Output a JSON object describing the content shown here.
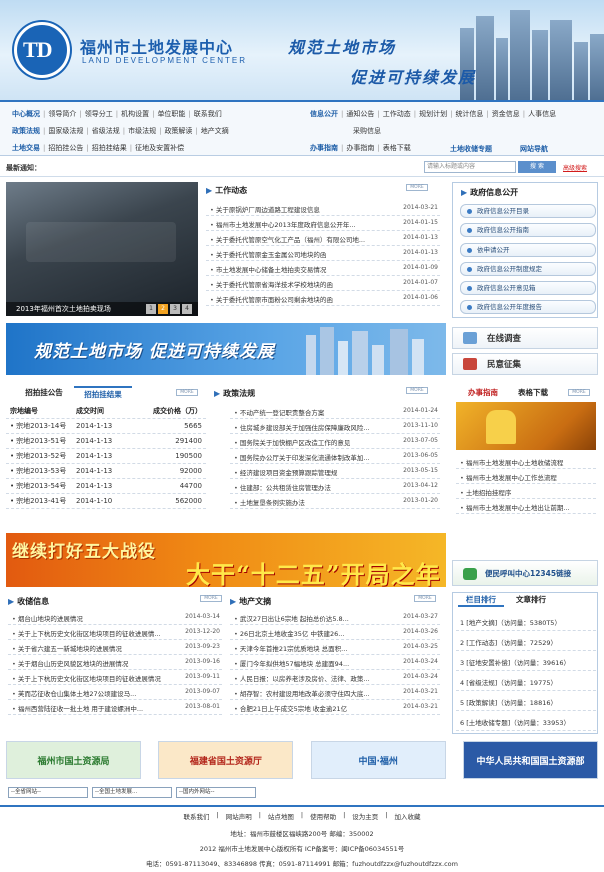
{
  "header": {
    "logo_mark": "TD",
    "title_cn": "福州市土地发展中心",
    "title_en": "LAND DEVELOPMENT CENTER",
    "slogan_line1": "规范土地市场",
    "slogan_line2": "促进可持续发展"
  },
  "nav": {
    "row1_group1": {
      "heading": "中心概况",
      "items": [
        "领导简介",
        "领导分工",
        "机构设置",
        "单位职能",
        "联系我们"
      ]
    },
    "row1_group2": {
      "heading": "信息公开",
      "items": [
        "通知公告",
        "工作动态",
        "规划计划",
        "统计信息",
        "资金信息",
        "人事信息"
      ]
    },
    "row2_group1": {
      "heading": "政策法规",
      "items": [
        "国家级法规",
        "省级法规",
        "市级法规",
        "政策解读",
        "地产文摘"
      ]
    },
    "row2_group2": {
      "items": [
        "采购信息"
      ]
    },
    "row3_group1": {
      "heading": "土地交易",
      "items": [
        "招拍挂公告",
        "招拍挂结果",
        "征地及安置补偿"
      ]
    },
    "row3_group2": {
      "heading": "办事指南",
      "items": [
        "办事指南",
        "表格下载"
      ]
    },
    "row3_extra1": "土地收储专题",
    "row3_extra2": "网站导航"
  },
  "notice": {
    "label": "最新通知：",
    "search_placeholder": "请输入标题或内容",
    "search_button": "搜 索",
    "advanced": "高级搜索"
  },
  "slideshow": {
    "caption": "2013年福州首次土地拍卖现场",
    "pages": [
      "1",
      "2",
      "3",
      "4"
    ],
    "active": "2"
  },
  "work": {
    "title": "工作动态",
    "more": "MORE",
    "items": [
      {
        "t": "关于原锅炉厂周边道路工程建设信息",
        "d": "2014-03-21"
      },
      {
        "t": "福州市土地发展中心2013年度政府信息公开年...",
        "d": "2014-01-15"
      },
      {
        "t": "关于委托代管原空气化工产品（福州）有限公司地...",
        "d": "2014-01-13"
      },
      {
        "t": "关于委托代管原金玉金属公司地块的函",
        "d": "2014-01-13"
      },
      {
        "t": "市土地发展中心储备土地拍卖交易情况",
        "d": "2014-01-09"
      },
      {
        "t": "关于委托代管原省海洋技术学校地块的函",
        "d": "2014-01-07"
      },
      {
        "t": "关于委托代管原市面粉公司剩余地块的函",
        "d": "2014-01-06"
      }
    ]
  },
  "gov": {
    "title": "政府信息公开",
    "items": [
      "政府信息公开目录",
      "政府信息公开指南",
      "依申请公开",
      "政府信息公开制度规定",
      "政府信息公开意见箱",
      "政府信息公开年度报告"
    ]
  },
  "banner1_text": "规范土地市场  促进可持续发展",
  "online_survey": "在线调查",
  "opinion": "民意征集",
  "tender": {
    "tab1": "招拍挂公告",
    "tab2": "招拍挂结果",
    "more": "MORE",
    "headers": [
      "宗地编号",
      "成交时间",
      "成交价格（万）"
    ],
    "rows": [
      [
        "宗地2013-14号",
        "2014-1-13",
        "5665"
      ],
      [
        "宗地2013-51号",
        "2014-1-13",
        "291400"
      ],
      [
        "宗地2013-52号",
        "2014-1-13",
        "190500"
      ],
      [
        "宗地2013-53号",
        "2014-1-13",
        "92000"
      ],
      [
        "宗地2013-54号",
        "2014-1-13",
        "44700"
      ],
      [
        "宗地2013-41号",
        "2014-1-10",
        "562000"
      ]
    ]
  },
  "policy": {
    "title": "政策法规",
    "more": "MORE",
    "items": [
      {
        "t": "不动产统一登记职责整合方案",
        "d": "2014-01-24"
      },
      {
        "t": "住房城乡建设部关于加强住房保障廉政风险...",
        "d": "2013-11-10"
      },
      {
        "t": "国务院关于加快棚户区改造工作的意见",
        "d": "2013-07-05"
      },
      {
        "t": "国务院办公厅关于印发深化流通体制改革加...",
        "d": "2013-06-05"
      },
      {
        "t": "经济建设项目资金预算跟踪管理规",
        "d": "2013-05-15"
      },
      {
        "t": "住建部：公共租赁住房管理办法",
        "d": "2013-04-12"
      },
      {
        "t": "土地复垦条例实施办法",
        "d": "2013-01-20"
      }
    ]
  },
  "guide": {
    "tab1": "办事指南",
    "tab2": "表格下载",
    "more": "MORE",
    "items": [
      "福州市土地发展中心土地收储流程",
      "福州市土地发展中心工作总流程",
      "土地招拍挂程序",
      "福州市土地发展中心土地出让前期..."
    ]
  },
  "banner2": {
    "line1": "继续打好五大战役",
    "line2": "大干“十二五”开局之年"
  },
  "hotline": "便民呼叫中心12345链接",
  "acquisition": {
    "title": "收储信息",
    "more": "MORE",
    "items": [
      {
        "t": "烟台山地块的进展情况",
        "d": "2014-03-14"
      },
      {
        "t": "关于上下杭历史文化街区地块项目的征收进展情...",
        "d": "2013-12-20"
      },
      {
        "t": "关于省六建五一新城地块的进展情况",
        "d": "2013-09-23"
      },
      {
        "t": "关于烟台山历史风貌区地块的进展情况",
        "d": "2013-09-16"
      },
      {
        "t": "关于上下杭历史文化街区地块项目的征收进展情况",
        "d": "2013-09-11"
      },
      {
        "t": "芙而芯征收仓山集体土地27公顷建设马...",
        "d": "2013-09-07"
      },
      {
        "t": "福州西营陆征收一批土地   用于建设螺洲中...",
        "d": "2013-08-01"
      }
    ]
  },
  "realestate": {
    "title": "地产文摘",
    "more": "MORE",
    "items": [
      {
        "t": "武汉27日出让6宗地  起拍总价达5.8...",
        "d": "2014-03-27"
      },
      {
        "t": "26日北京土地收金35亿  中铁建26...",
        "d": "2014-03-26"
      },
      {
        "t": "天津今年首推21宗优质地块  总面积...",
        "d": "2014-03-25"
      },
      {
        "t": "厦门今年拟供地57幅地块  总建面94...",
        "d": "2014-03-24"
      },
      {
        "t": "人民日报：以房养老涉及房价、法律、政策...",
        "d": "2014-03-24"
      },
      {
        "t": "胡存智：农村建设用地改革必须守住四大底...",
        "d": "2014-03-21"
      },
      {
        "t": "合肥21日上午成交5宗地  收金逾21亿",
        "d": "2014-03-21"
      }
    ]
  },
  "ranking": {
    "tab1": "栏目排行",
    "tab2": "文章排行",
    "items": [
      {
        "rank": "1",
        "name": "[地产文摘]",
        "visits": "（访问量：5380T5）"
      },
      {
        "rank": "2",
        "name": "[工作动态]",
        "visits": "（访问量：72529）"
      },
      {
        "rank": "3",
        "name": "[征地安置补偿]",
        "visits": "（访问量：39616）"
      },
      {
        "rank": "4",
        "name": "[省级法规]",
        "visits": "（访问量：19775）"
      },
      {
        "rank": "5",
        "name": "[政策解读]",
        "visits": "（访问量：18816）"
      },
      {
        "rank": "6",
        "name": "[土地收储专题]",
        "visits": "（访问量：33953）"
      }
    ]
  },
  "partner_links": [
    {
      "text": "福州市国土资源局",
      "color": "#2a7a2f",
      "bg": "#dff0dc"
    },
    {
      "text": "福建省国土资源厅",
      "color": "#b3261b",
      "bg": "#fbe8c8"
    },
    {
      "text": "中国·福州",
      "color": "#1f5fa8",
      "bg": "#e1eefb"
    },
    {
      "text": "中华人民共和国国土资源部",
      "color": "#ffffff",
      "bg": "#2b5aa6"
    }
  ],
  "selects": [
    "--全省网站--",
    "--全国土地发展...",
    "--国内外网站--"
  ],
  "footer": {
    "links": [
      "联系我们",
      "网站声明",
      "站点地图",
      "使用帮助",
      "设为主页",
      "加入收藏"
    ],
    "address": "地址：福州市鼓楼区福峡路200号  邮编：350002",
    "copyright": "2012  福州市土地发展中心版权所有  ICP备案号：闽ICP备06034551号",
    "contact": "电话：0591-87113049、83346898  传真：0591-87114991  邮箱：fuzhoutdfzzx@fuzhoutdfzzx.com"
  }
}
